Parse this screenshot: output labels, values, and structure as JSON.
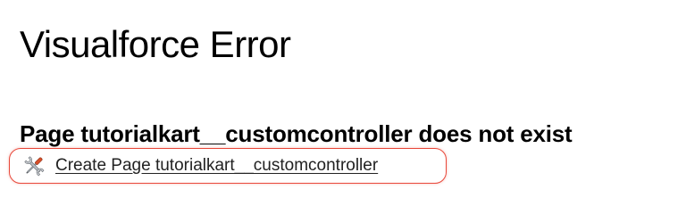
{
  "page": {
    "title": "Visualforce Error"
  },
  "error": {
    "message": "Page tutorialkart__customcontroller does not exist"
  },
  "action": {
    "icon": "wrench-and-screwdriver-icon",
    "link_label": "Create Page tutorialkart__customcontroller",
    "highlight_color": "#e8483a"
  }
}
